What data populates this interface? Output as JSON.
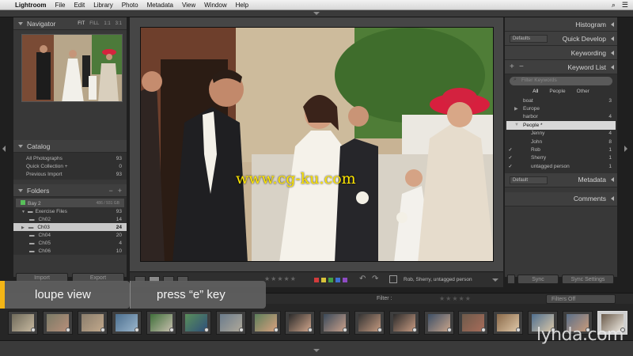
{
  "menubar": {
    "apple": "",
    "app": "Lightroom",
    "items": [
      "File",
      "Edit",
      "Library",
      "Photo",
      "Metadata",
      "View",
      "Window",
      "Help"
    ]
  },
  "left": {
    "navigator": {
      "title": "Navigator",
      "zoom": [
        "FIT",
        "FILL",
        "1:1",
        "3:1"
      ]
    },
    "catalog": {
      "title": "Catalog",
      "rows": [
        {
          "label": "All Photographs",
          "count": "93"
        },
        {
          "label": "Quick Collection +",
          "count": "0"
        },
        {
          "label": "Previous Import",
          "count": "93"
        }
      ]
    },
    "folders": {
      "title": "Folders",
      "volume": "Bay 2",
      "volume_size": "486 / 931 GB",
      "parent": "Exercise Files",
      "parent_count": "93",
      "rows": [
        {
          "label": "Ch02",
          "count": "14"
        },
        {
          "label": "Ch03",
          "count": "24"
        },
        {
          "label": "Ch04",
          "count": "20"
        },
        {
          "label": "Ch05",
          "count": "4"
        },
        {
          "label": "Ch06",
          "count": "10"
        }
      ]
    },
    "import_label": "Import",
    "export_label": "Export"
  },
  "photo": {
    "watermark": "www.cg-ku.com"
  },
  "right": {
    "histogram": "Histogram",
    "quick_develop": "Quick Develop",
    "preset": "Defaults",
    "keywording": "Keywording",
    "keyword_list": "Keyword List",
    "filter_placeholder": "Filter Keywords",
    "tabs": [
      "All",
      "People",
      "Other"
    ],
    "keywords": [
      {
        "label": "boat",
        "count": "3",
        "check": "",
        "tri": "",
        "sel": false
      },
      {
        "label": "Europe",
        "count": "",
        "check": "",
        "tri": "▶",
        "sel": false
      },
      {
        "label": "harbor",
        "count": "4",
        "check": "",
        "tri": "",
        "sel": false
      },
      {
        "label": "People *",
        "count": "",
        "check": "",
        "tri": "▼",
        "sel": true
      },
      {
        "label": "Jenny",
        "count": "4",
        "check": "",
        "tri": "",
        "sel": false
      },
      {
        "label": "John",
        "count": "8",
        "check": "",
        "tri": "",
        "sel": false
      },
      {
        "label": "Rob",
        "count": "1",
        "check": "✓",
        "tri": "",
        "sel": false
      },
      {
        "label": "Sherry",
        "count": "1",
        "check": "✓",
        "tri": "",
        "sel": false
      },
      {
        "label": "untagged person",
        "count": "1",
        "check": "✓",
        "tri": "",
        "sel": false
      }
    ],
    "metadata": "Metadata",
    "meta_preset": "Default",
    "comments": "Comments",
    "sync": "Sync",
    "sync_settings": "Sync Settings"
  },
  "toolbar": {
    "keywords": "Rob, Sherry, untagged person"
  },
  "filmstrip": {
    "filter_label": "Filter :",
    "filters_off": "Filters Off"
  },
  "captions": {
    "mode": "loupe view",
    "shortcut": "press “e” key"
  },
  "brand": "lynda.com",
  "colors": {
    "accent": "#f3b516",
    "label_red": "#d23c3c",
    "label_yellow": "#d8c23a",
    "label_green": "#43a047",
    "label_blue": "#3f6fd1",
    "label_purple": "#8e4bc2"
  }
}
